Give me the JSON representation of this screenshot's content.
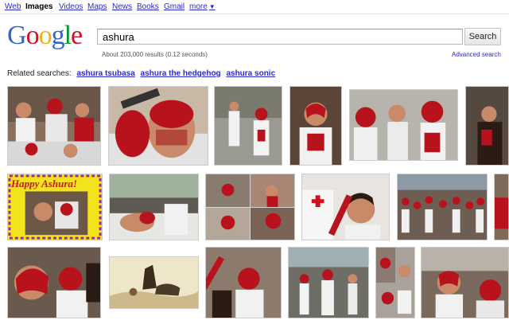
{
  "nav": {
    "items": [
      "Web",
      "Images",
      "Videos",
      "Maps",
      "News",
      "Books",
      "Gmail",
      "more"
    ],
    "active": "Images",
    "more_arrow": "▼"
  },
  "logo": {
    "letters": [
      "G",
      "o",
      "o",
      "g",
      "l",
      "e"
    ]
  },
  "search": {
    "query": "ashura",
    "button_label": "Search",
    "advanced_link": "Advanced search",
    "stats": "About 203,000 results (0.12 seconds)"
  },
  "related": {
    "label": "Related searches:",
    "links": [
      "ashura tsubasa",
      "ashura the hedgehog",
      "ashura sonic"
    ]
  },
  "thumbnails": {
    "happy_text": "Happy Ashura!"
  },
  "colors": {
    "blood": "#b8131c",
    "skin": "#c98a6a",
    "white_cloth": "#f1f1f1",
    "dark": "#2a1b15"
  }
}
